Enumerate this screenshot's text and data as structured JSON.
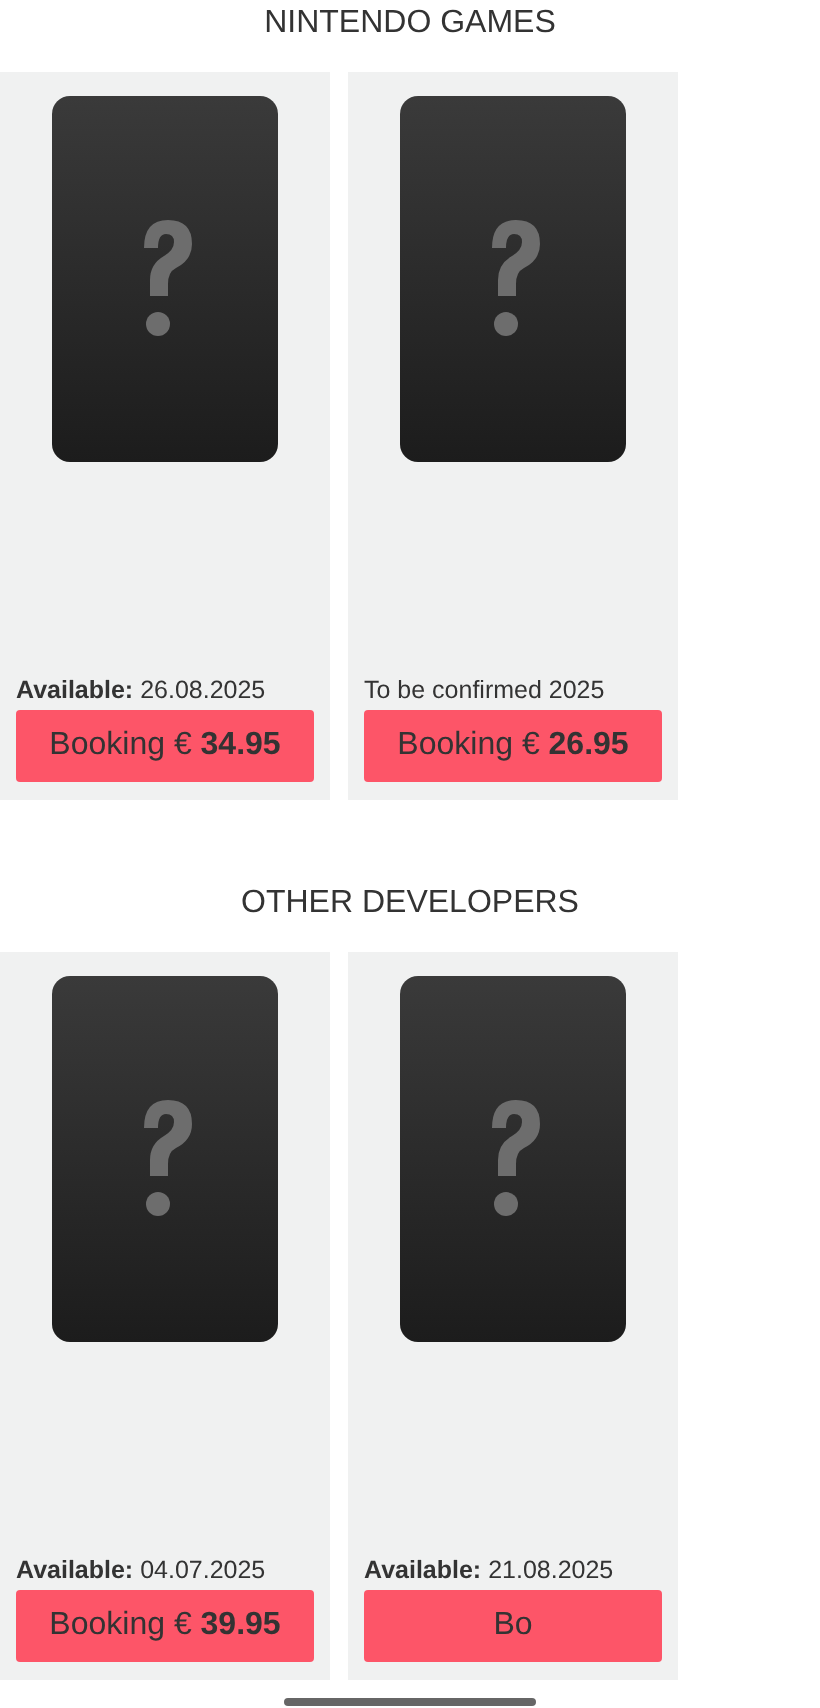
{
  "sections": [
    {
      "title": "NINTENDO GAMES",
      "products": [
        {
          "availability": "**Available:** 26.08.2025",
          "button": "Booking € **34.95**"
        },
        {
          "availability": "To be confirmed 2025",
          "button": "Booking € **26.95**"
        }
      ]
    },
    {
      "title": "OTHER DEVELOPERS",
      "products": [
        {
          "availability": "**Available:** 04.07.2025",
          "button": "Booking € **39.95**"
        },
        {
          "availability": "**Available:** 21.08.2025",
          "button": "Bo"
        }
      ]
    }
  ]
}
